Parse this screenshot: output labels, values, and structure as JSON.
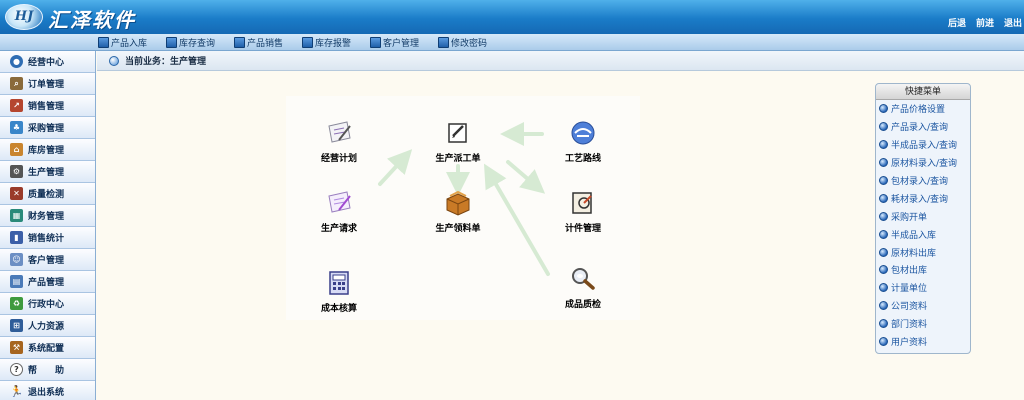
{
  "header": {
    "logo_mark": "HJ",
    "title": "汇泽软件",
    "links": [
      "后退",
      "前进",
      "退出"
    ]
  },
  "toolbar": {
    "items": [
      {
        "label": "产品入库",
        "icon": "doc-icon"
      },
      {
        "label": "库存查询",
        "icon": "doc-icon"
      },
      {
        "label": "产品销售",
        "icon": "doc-icon"
      },
      {
        "label": "库存报警",
        "icon": "doc-icon"
      },
      {
        "label": "客户管理",
        "icon": "users-icon"
      },
      {
        "label": "修改密码",
        "icon": "key-icon"
      }
    ]
  },
  "sidebar": {
    "items": [
      {
        "label": "经营中心",
        "icon": "globe-icon"
      },
      {
        "label": "订单管理",
        "icon": "search-doc-icon"
      },
      {
        "label": "销售管理",
        "icon": "chart-icon"
      },
      {
        "label": "采购管理",
        "icon": "people-icon"
      },
      {
        "label": "库房管理",
        "icon": "house-icon"
      },
      {
        "label": "生产管理",
        "icon": "gears-icon"
      },
      {
        "label": "质量检测",
        "icon": "tools-icon"
      },
      {
        "label": "财务管理",
        "icon": "calculator-icon"
      },
      {
        "label": "销售统计",
        "icon": "bar-chart-icon"
      },
      {
        "label": "客户管理",
        "icon": "customers-icon"
      },
      {
        "label": "产品管理",
        "icon": "grid-icon"
      },
      {
        "label": "行政中心",
        "icon": "recycle-icon"
      },
      {
        "label": "人力资源",
        "icon": "org-icon"
      },
      {
        "label": "系统配置",
        "icon": "wrench-icon"
      },
      {
        "label": "帮　　助",
        "icon": "help-icon"
      },
      {
        "label": "退出系统",
        "icon": "exit-icon"
      }
    ]
  },
  "breadcrumb": {
    "text": "当前业务：生产管理"
  },
  "flow": {
    "nodes": [
      {
        "id": "jyjh",
        "label": "经营计划",
        "icon": "paper-icon"
      },
      {
        "id": "scpgd",
        "label": "生产派工单",
        "icon": "notepad-icon"
      },
      {
        "id": "gylx",
        "label": "工艺路线",
        "icon": "route-icon"
      },
      {
        "id": "scqq",
        "label": "生产请求",
        "icon": "paper-purple-icon"
      },
      {
        "id": "sclld",
        "label": "生产领料单",
        "icon": "box-icon"
      },
      {
        "id": "jjgl",
        "label": "计件管理",
        "icon": "piece-icon"
      },
      {
        "id": "cbhs",
        "label": "成本核算",
        "icon": "calc-icon"
      },
      {
        "id": "cpzj",
        "label": "成品质检",
        "icon": "magnifier-icon"
      }
    ]
  },
  "quick_menu": {
    "title": "快捷菜单",
    "items": [
      "产品价格设置",
      "产品录入/查询",
      "半成品录入/查询",
      "原材料录入/查询",
      "包材录入/查询",
      "耗材录入/查询",
      "采购开单",
      "半成品入库",
      "原材料出库",
      "包材出库",
      "计量单位",
      "公司资料",
      "部门资料",
      "用户资料"
    ]
  },
  "colors": {
    "header_blue": "#1a7cc8",
    "arrow_green": "#d6ead3",
    "link_blue": "#1b55a0"
  }
}
